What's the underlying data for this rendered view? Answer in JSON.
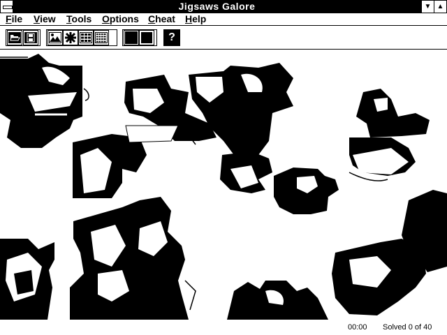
{
  "window": {
    "title": "Jigsaws Galore",
    "minimize_glyph": "▼",
    "maximize_glyph": "▲"
  },
  "menu": [
    {
      "first": "F",
      "rest": "ile"
    },
    {
      "first": "V",
      "rest": "iew"
    },
    {
      "first": "T",
      "rest": "ools"
    },
    {
      "first": "O",
      "rest": "ptions"
    },
    {
      "first": "C",
      "rest": "heat"
    },
    {
      "first": "H",
      "rest": "elp"
    }
  ],
  "toolbar": {
    "icons": [
      "open-folder-icon",
      "save-disk-icon",
      "picture-icon",
      "shuffle-icon",
      "grid-small-icon",
      "grid-large-icon",
      "black-square-icon",
      "black-square-icon",
      "help-icon"
    ],
    "help_glyph": "?"
  },
  "status": {
    "time": "00:00",
    "solved": "Solved 0 of 40"
  }
}
